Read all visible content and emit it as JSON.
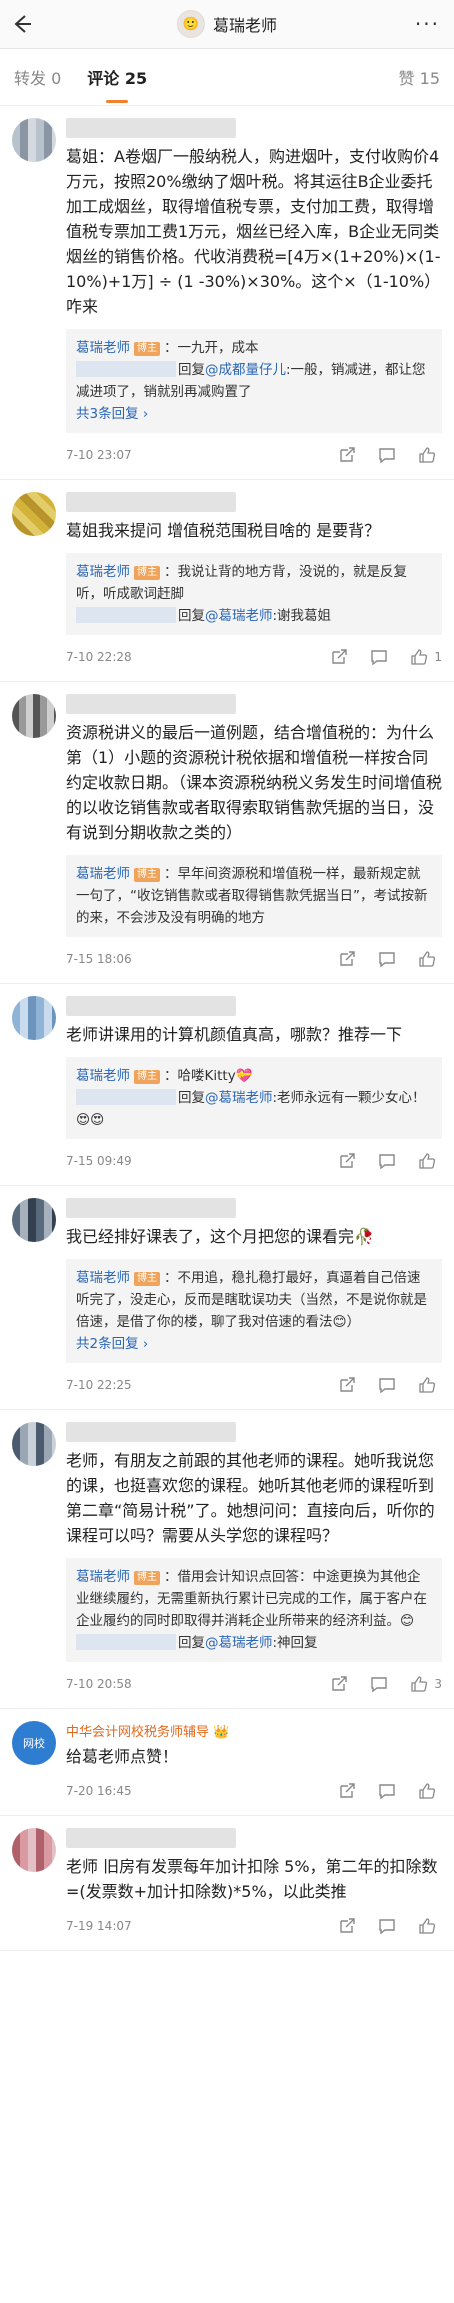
{
  "header": {
    "back_icon": "back-arrow-icon",
    "title": "葛瑞老师",
    "more_icon": "more-icon"
  },
  "tabs": [
    {
      "label": "转发 0"
    },
    {
      "label": "评论 25"
    },
    {
      "label": "赞 15"
    }
  ],
  "badge_text": "博主",
  "teacher_name": "葛瑞老师",
  "comments": [
    {
      "text": "葛姐：A卷烟厂一般纳税人，购进烟叶，支付收购价4万元，按照20%缴纳了烟叶税。将其运往B企业委托加工成烟丝，取得增值税专票，支付加工费，取得增值税专票加工费1万元，烟丝已经入库，B企业无同类烟丝的销售价格。代收消费税=[4万×(1+20%)×(1-10%)+1万] ÷ (1 -30%)×30%。这个×（1-10%） 咋来",
      "reply1": "：一九开，成本",
      "reply2_prefix": "回复",
      "reply2_at": "@成都量仔儿",
      "reply2_text": ":一般，销减进，都让您减进项了，销就别再减购置了",
      "more_replies": "共3条回复 ›",
      "time": "7-10 23:07",
      "likes": ""
    },
    {
      "text": "葛姐我来提问 增值税范围税目啥的 是要背？",
      "reply1": "：我说让背的地方背，没说的，就是反复听，听成歌词赶脚",
      "reply2_prefix": "回复",
      "reply2_at": "@葛瑞老师",
      "reply2_text": ":谢我葛姐",
      "time": "7-10 22:28",
      "likes": "1"
    },
    {
      "text": "资源税讲义的最后一道例题，结合增值税的：为什么第（1）小题的资源税计税依据和增值税一样按合同约定收款日期。（课本资源税纳税义务发生时间增值税的以收讫销售款或者取得索取销售款凭据的当日，没有说到分期收款之类的）",
      "reply1": "：早年间资源税和增值税一样，最新规定就一句了，“收讫销售款或者取得销售款凭据当日”，考试按新的来，不会涉及没有明确的地方",
      "time": "7-15 18:06",
      "likes": ""
    },
    {
      "text": "老师讲课用的计算机颜值真高，哪款？推荐一下",
      "reply1": "：哈喽Kitty💝",
      "reply2_prefix": "回复",
      "reply2_at": "@葛瑞老师",
      "reply2_text": ":老师永远有一颗少女心！😍😍",
      "time": "7-15 09:49",
      "likes": ""
    },
    {
      "text": "我已经排好课表了，这个月把您的课看完🥀",
      "reply1": "：不用追，稳扎稳打最好，真逼着自己倍速听完了，没走心，反而是瞎耽误功夫（当然，不是说你就是倍速，是借了你的楼，聊了我对倍速的看法😊）",
      "more_replies": "共2条回复 ›",
      "time": "7-10 22:25",
      "likes": ""
    },
    {
      "text": "老师，有朋友之前跟的其他老师的课程。她听我说您的课，也挺喜欢您的课程。她听其他老师的课程听到第二章“简易计税”了。她想问问：直接向后，听你的课程可以吗？需要从头学您的课程吗？",
      "reply1_lead": "：借用会计知识点回答：中途更换为其他企业继续履约，无需重新执行累计已完成的工作，属于客户在企业履约的同时即取得并消耗企业所带来的经济利益。😊",
      "reply2_prefix": "回复",
      "reply2_at": "@葛瑞老师",
      "reply2_text": ":神回复",
      "time": "7-10 20:58",
      "likes": "3"
    },
    {
      "org_name": "中华会计网校税务师辅导 👑",
      "avatar_text": "网校",
      "text": "给葛老师点赞！",
      "time": "7-20 16:45",
      "likes": ""
    },
    {
      "text": "老师 旧房有发票每年加计扣除 5%，第二年的扣除数=(发票数+加计扣除数)*5%，以此类推",
      "time": "7-19 14:07",
      "likes": ""
    }
  ]
}
